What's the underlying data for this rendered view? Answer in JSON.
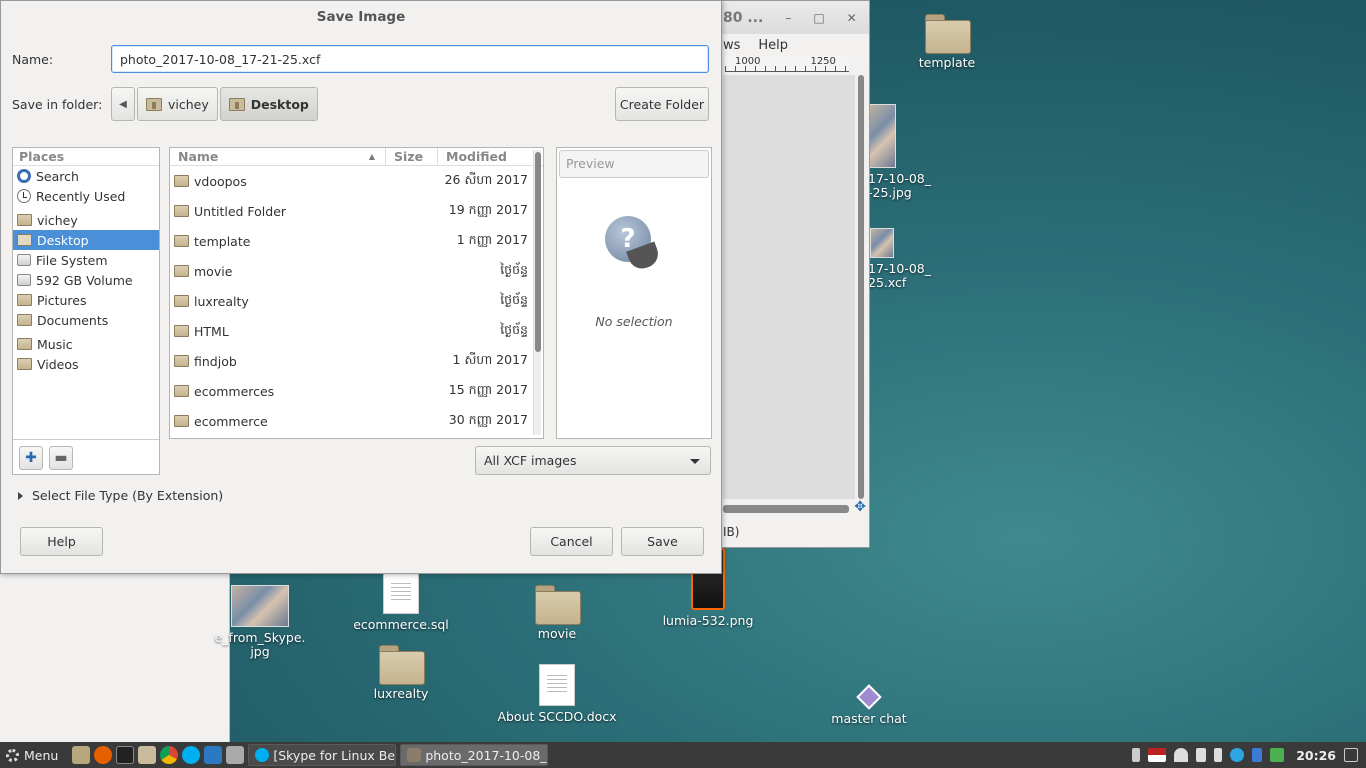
{
  "dialog": {
    "title": "Save Image",
    "name_label": "Name:",
    "filename": "photo_2017-10-08_17-21-25.xcf",
    "folder_label": "Save in folder:",
    "path": [
      "vichey",
      "Desktop"
    ],
    "create_folder": "Create Folder",
    "places_header": "Places",
    "places": [
      {
        "label": "Search",
        "icon": "search-icon"
      },
      {
        "label": "Recently Used",
        "icon": "clock-icon"
      },
      {
        "label": "vichey",
        "icon": "home-folder-icon"
      },
      {
        "label": "Desktop",
        "icon": "desktop-folder-icon",
        "selected": true
      },
      {
        "label": "File System",
        "icon": "drive-icon"
      },
      {
        "label": "592 GB Volume",
        "icon": "drive-icon"
      },
      {
        "label": "Pictures",
        "icon": "folder-icon"
      },
      {
        "label": "Documents",
        "icon": "folder-icon"
      },
      {
        "label": "Music",
        "icon": "folder-icon"
      },
      {
        "label": "Videos",
        "icon": "folder-icon"
      }
    ],
    "columns": {
      "name": "Name",
      "size": "Size",
      "modified": "Modified"
    },
    "files": [
      {
        "name": "vdoopos",
        "modified": "26 សីហា 2017"
      },
      {
        "name": "Untitled Folder",
        "modified": "19 កញ្ញា 2017"
      },
      {
        "name": "template",
        "modified": "1 កញ្ញា 2017"
      },
      {
        "name": "movie",
        "modified": "ថ្ងៃច័ន្ទ"
      },
      {
        "name": "luxrealty",
        "modified": "ថ្ងៃច័ន្ទ"
      },
      {
        "name": "HTML",
        "modified": "ថ្ងៃច័ន្ទ"
      },
      {
        "name": "findjob",
        "modified": "1 សីហា 2017"
      },
      {
        "name": "ecommerces",
        "modified": "15 កញ្ញា 2017"
      },
      {
        "name": "ecommerce",
        "modified": "30 កញ្ញា 2017"
      }
    ],
    "preview_label": "Preview",
    "preview_empty": "No selection",
    "filter": "All XCF images",
    "file_type_expander": "Select File Type (By Extension)",
    "help": "Help",
    "cancel": "Cancel",
    "save": "Save"
  },
  "gimp_window": {
    "title": "80 ...",
    "menu": [
      "ws",
      "Help"
    ],
    "ruler": [
      "1000",
      "1250"
    ],
    "status": "IB)"
  },
  "desktop": {
    "icons": [
      {
        "label": "template",
        "kind": "folder"
      },
      {
        "label": "17-10-08_\n-25.jpg",
        "kind": "photo"
      },
      {
        "label": "17-10-08_\n25.xcf",
        "kind": "photo"
      },
      {
        "label": "e_from_Skype.\njpg",
        "kind": "photo"
      },
      {
        "label": "ecommerce.sql",
        "kind": "document"
      },
      {
        "label": "movie",
        "kind": "folder"
      },
      {
        "label": "lumia-532.png",
        "kind": "phone"
      },
      {
        "label": "luxrealty",
        "kind": "folder"
      },
      {
        "label": "About SCCDO.docx",
        "kind": "document"
      },
      {
        "label": "master chat",
        "kind": "chat"
      }
    ]
  },
  "taskbar": {
    "menu": "Menu",
    "tasks": [
      {
        "label": "[Skype for Linux Be...",
        "icon": "skype-icon"
      },
      {
        "label": "photo_2017-10-08_...",
        "icon": "gimp-icon",
        "active": true
      }
    ],
    "clock": "20:26"
  },
  "colors": {
    "accent": "#4a90d9",
    "desktop": "#2c6f78",
    "taskbar": "#3a3a3a"
  }
}
